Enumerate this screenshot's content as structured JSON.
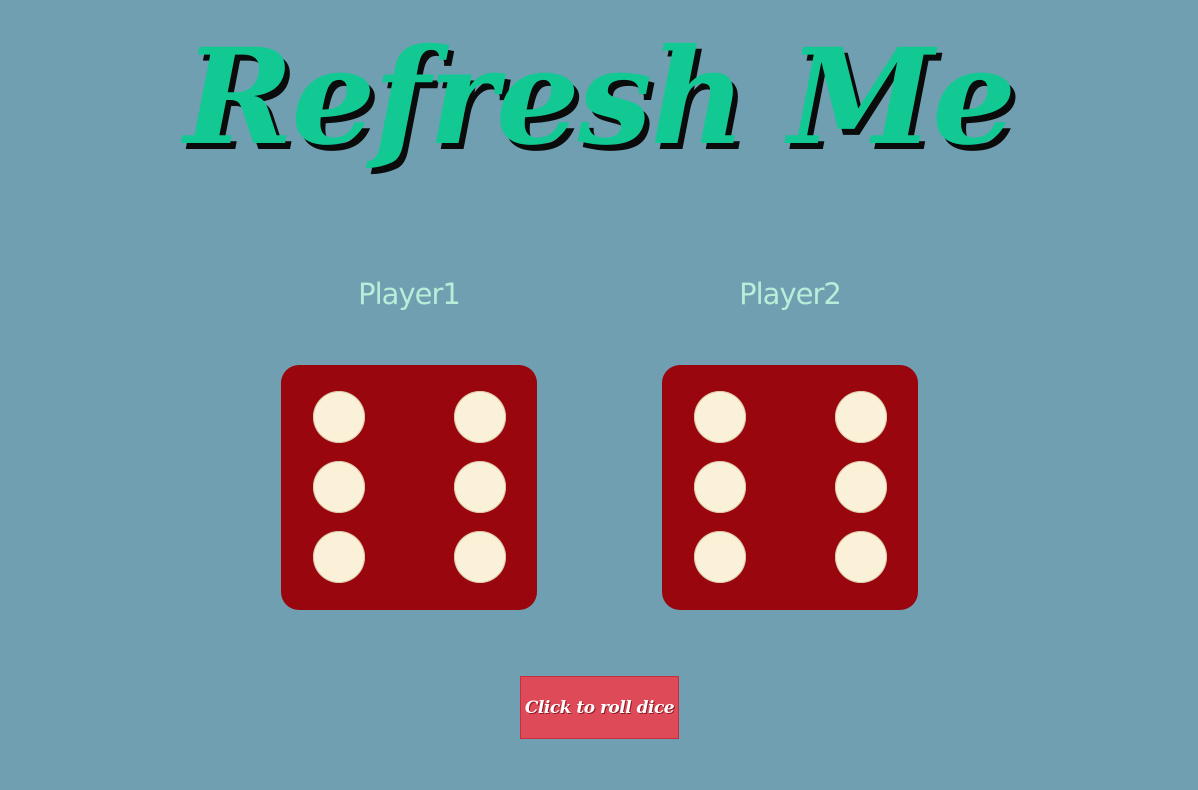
{
  "title": "Refresh Me",
  "players": [
    {
      "label": "Player1",
      "die_value": 6
    },
    {
      "label": "Player2",
      "die_value": 6
    }
  ],
  "roll_button": {
    "label": "Click to roll dice"
  },
  "colors": {
    "background": "#6f9fb0",
    "title": "#12c994",
    "player_label": "#b9ecd9",
    "die": "#99060e",
    "pip": "#fbf1d8",
    "button": "#de4a58"
  }
}
